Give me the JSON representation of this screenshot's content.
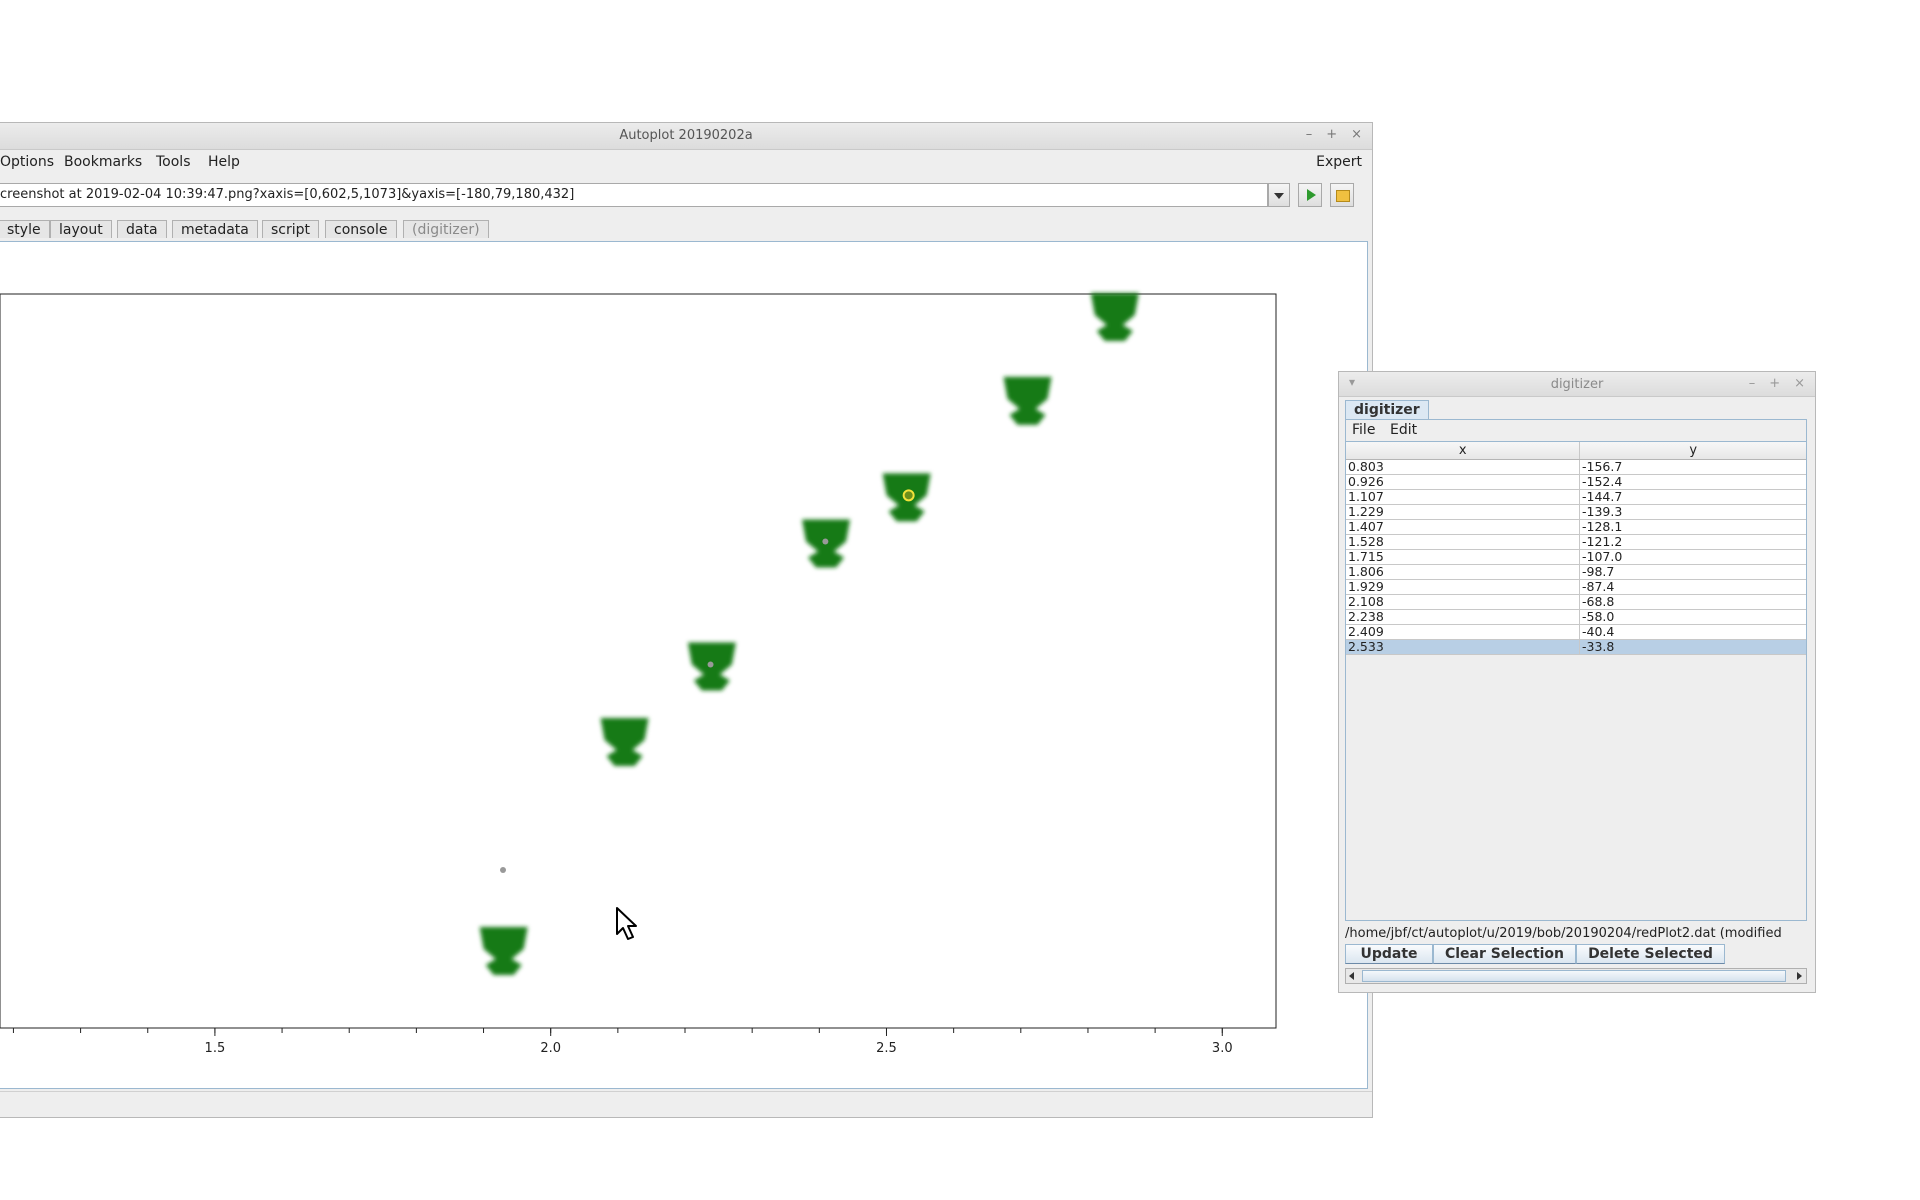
{
  "main_window": {
    "title": "Autoplot 20190202a",
    "controls": {
      "minimize": "–",
      "maximize": "+",
      "close": "×"
    },
    "menu": [
      "Options",
      "Bookmarks",
      "Tools",
      "Help"
    ],
    "expert": "Expert",
    "address": "creenshot at 2019-02-04 10:39:47.png?xaxis=[0,602,5,1073]&yaxis=[-180,79,180,432]",
    "tabs": [
      "style",
      "layout",
      "data",
      "metadata",
      "script",
      "console",
      "(digitizer)"
    ]
  },
  "chart_data": {
    "type": "scatter",
    "xlim": [
      1.18,
      3.08
    ],
    "x_ticks": [
      1.5,
      2.0,
      2.5,
      3.0
    ],
    "x_tick_labels": [
      "1.5",
      "2.0",
      "2.5",
      "3.0"
    ],
    "x_minor_step": 0.1,
    "marker_color": "#127a12",
    "points": [
      {
        "x": 1.93,
        "y": -98.7
      },
      {
        "x": 2.11,
        "y": -68.8
      },
      {
        "x": 2.24,
        "y": -58.0
      },
      {
        "x": 2.41,
        "y": -40.4
      },
      {
        "x": 2.53,
        "y": -33.8
      },
      {
        "x": 2.71,
        "y": -20.0
      },
      {
        "x": 2.84,
        "y": -8.0
      }
    ],
    "digitized_points": [
      {
        "x": 1.929,
        "y": -87.4
      },
      {
        "x": 2.238,
        "y": -58.0
      },
      {
        "x": 2.409,
        "y": -40.4
      },
      {
        "x": 2.533,
        "y": -33.8,
        "selected": true
      }
    ]
  },
  "digitizer": {
    "title": "digitizer",
    "controls": {
      "menu": "▾",
      "minimize": "–",
      "maximize": "+",
      "close": "×"
    },
    "tab": "digitizer",
    "menu": [
      "File",
      "Edit"
    ],
    "columns": [
      "x",
      "y"
    ],
    "rows": [
      [
        "0.803",
        "-156.7"
      ],
      [
        "0.926",
        "-152.4"
      ],
      [
        "1.107",
        "-144.7"
      ],
      [
        "1.229",
        "-139.3"
      ],
      [
        "1.407",
        "-128.1"
      ],
      [
        "1.528",
        "-121.2"
      ],
      [
        "1.715",
        "-107.0"
      ],
      [
        "1.806",
        "-98.7"
      ],
      [
        "1.929",
        "-87.4"
      ],
      [
        "2.108",
        "-68.8"
      ],
      [
        "2.238",
        "-58.0"
      ],
      [
        "2.409",
        "-40.4"
      ],
      [
        "2.533",
        "-33.8"
      ]
    ],
    "selected_row": 12,
    "filepath": "/home/jbf/ct/autoplot/u/2019/bob/20190204/redPlot2.dat (modified",
    "buttons": [
      "Update",
      "Clear Selection",
      "Delete Selected"
    ]
  }
}
